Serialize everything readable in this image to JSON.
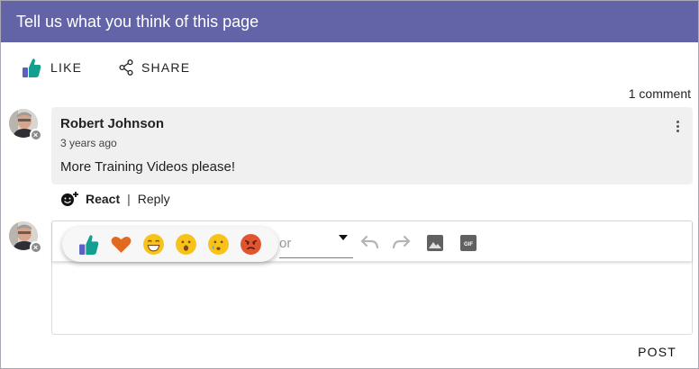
{
  "header": {
    "title": "Tell us what you think of this page"
  },
  "actions": {
    "like_label": "LIKE",
    "share_label": "SHARE"
  },
  "comments": {
    "count_label": "1 comment",
    "items": [
      {
        "author": "Robert Johnson",
        "time": "3 years ago",
        "text": "More Training Videos please!",
        "react_label": "React",
        "separator": "|",
        "reply_label": "Reply"
      }
    ]
  },
  "editor": {
    "font_select_visible_text": "or",
    "toolbar_icons": [
      "undo-icon",
      "redo-icon",
      "image-icon",
      "gif-icon"
    ],
    "gif_icon_text": "GIF",
    "post_label": "POST"
  },
  "reactions": [
    "like-icon",
    "heart-icon",
    "laugh-icon",
    "surprised-icon",
    "sad-icon",
    "angry-icon"
  ],
  "colors": {
    "header_bg": "#6264a7",
    "like_green": "#139f8f",
    "heart_orange": "#e2691d",
    "emoji_yellow": "#f7c31a",
    "angry_orange": "#e0542f"
  }
}
